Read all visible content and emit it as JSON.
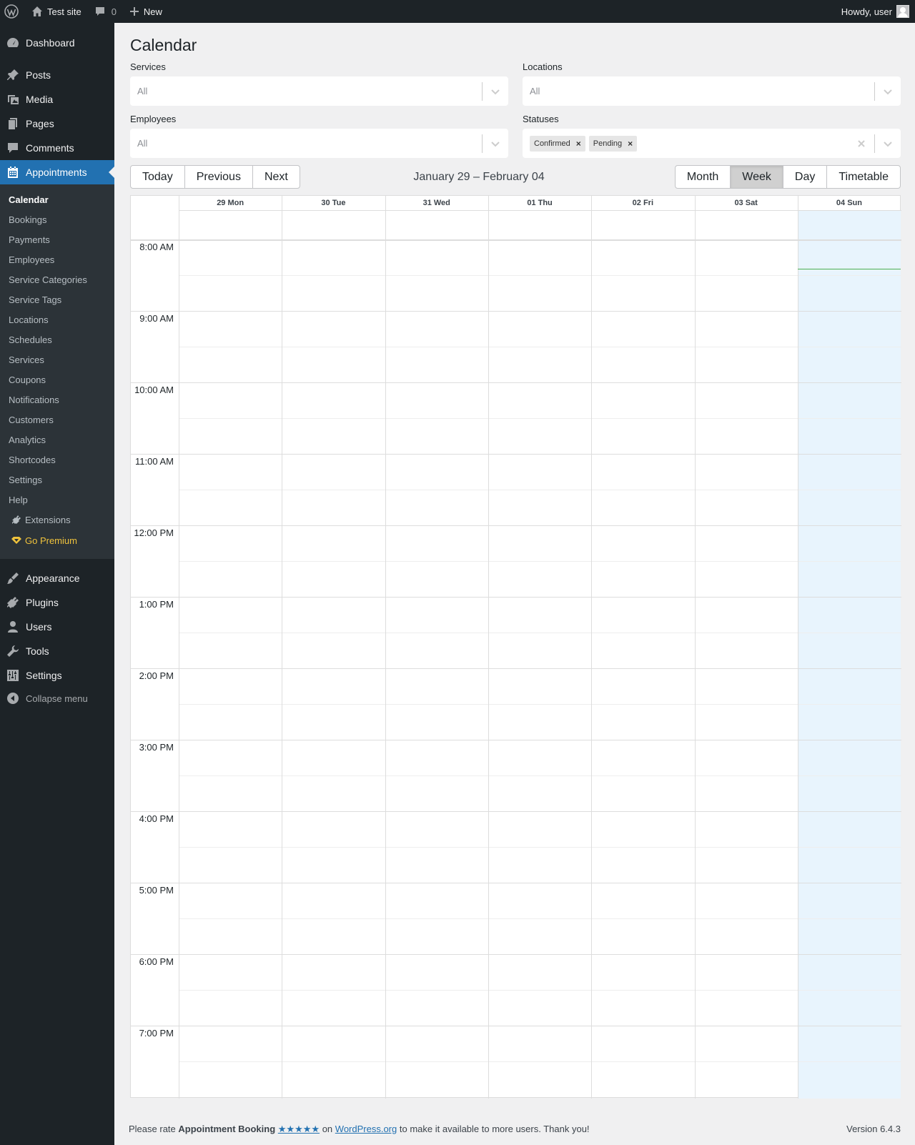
{
  "adminbar": {
    "site_name": "Test site",
    "comments_count": "0",
    "new_label": "New",
    "greeting": "Howdy, user"
  },
  "sidebar": {
    "dashboard": "Dashboard",
    "posts": "Posts",
    "media": "Media",
    "pages": "Pages",
    "comments": "Comments",
    "appointments": "Appointments",
    "submenu": {
      "calendar": "Calendar",
      "bookings": "Bookings",
      "payments": "Payments",
      "employees": "Employees",
      "service_categories": "Service Categories",
      "service_tags": "Service Tags",
      "locations": "Locations",
      "schedules": "Schedules",
      "services": "Services",
      "coupons": "Coupons",
      "notifications": "Notifications",
      "customers": "Customers",
      "analytics": "Analytics",
      "shortcodes": "Shortcodes",
      "settings": "Settings",
      "help": "Help",
      "extensions": "Extensions",
      "go_premium": "Go Premium"
    },
    "appearance": "Appearance",
    "plugins": "Plugins",
    "users": "Users",
    "tools": "Tools",
    "settings": "Settings",
    "collapse": "Collapse menu"
  },
  "page": {
    "title": "Calendar"
  },
  "filters": {
    "services_label": "Services",
    "services_value": "All",
    "locations_label": "Locations",
    "locations_value": "All",
    "employees_label": "Employees",
    "employees_value": "All",
    "statuses_label": "Statuses",
    "statuses_chips": [
      "Confirmed",
      "Pending"
    ]
  },
  "toolbar": {
    "today": "Today",
    "previous": "Previous",
    "next": "Next",
    "range": "January 29 – February 04",
    "views": [
      "Month",
      "Week",
      "Day",
      "Timetable"
    ],
    "active_view": "Week"
  },
  "calendar": {
    "days": [
      "29 Mon",
      "30 Tue",
      "31 Wed",
      "01 Thu",
      "02 Fri",
      "03 Sat",
      "04 Sun"
    ],
    "today_index": 6,
    "times": [
      "8:00 AM",
      "9:00 AM",
      "10:00 AM",
      "11:00 AM",
      "12:00 PM",
      "1:00 PM",
      "2:00 PM",
      "3:00 PM",
      "4:00 PM",
      "5:00 PM",
      "6:00 PM",
      "7:00 PM"
    ]
  },
  "footer": {
    "pre": "Please rate",
    "plugin_name": "Appointment Booking",
    "stars": "★★★★★",
    "on": "on",
    "link": "WordPress.org",
    "post": "to make it available to more users. Thank you!",
    "version": "Version 6.4.3"
  },
  "colors": {
    "adminbar_bg": "#1d2327",
    "accent": "#2271b1",
    "submenu_bg": "#2c3338",
    "premium": "#f0c33c",
    "today_bg": "#e8f4fd",
    "now_line": "#4caf50"
  }
}
